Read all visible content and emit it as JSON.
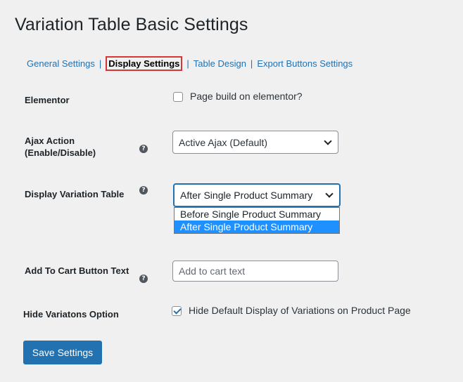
{
  "page": {
    "title": "Variation Table Basic Settings"
  },
  "tabs": [
    {
      "label": "General Settings"
    },
    {
      "label": "Display Settings"
    },
    {
      "label": "Table Design"
    },
    {
      "label": "Export Buttons Settings"
    }
  ],
  "separator": "|",
  "help_icon_glyph": "?",
  "elementor": {
    "label": "Elementor",
    "checkbox_label": "Page build on elementor?",
    "checked": false
  },
  "ajax": {
    "label_line1": "Ajax Action",
    "label_line2": "(Enable/Disable)",
    "selected": "Active Ajax (Default)"
  },
  "display_table": {
    "label": "Display Variation Table",
    "selected": "After Single Product Summary",
    "options": [
      "Before Single Product Summary",
      "After Single Product Summary"
    ]
  },
  "add_to_cart": {
    "label": "Add To Cart Button Text",
    "placeholder": "Add to cart text",
    "value": ""
  },
  "hide_variations": {
    "label": "Hide Variatons Option",
    "checkbox_label": "Hide Default Display of Variations on Product Page",
    "checked": true
  },
  "save_button": {
    "label": "Save Settings"
  },
  "colors": {
    "accent": "#2271b1",
    "highlight_border": "#d63638",
    "option_selected": "#1e90ff",
    "background": "#f0f0f1"
  }
}
